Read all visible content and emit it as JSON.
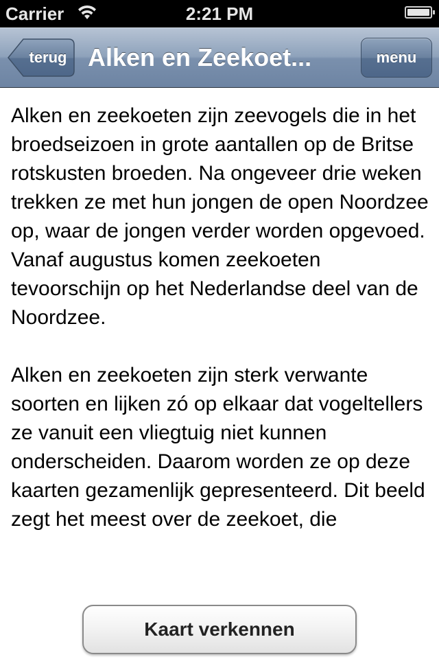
{
  "status_bar": {
    "carrier": "Carrier",
    "time": "2:21 PM",
    "wifi_icon": "wifi-icon",
    "battery_icon": "battery-icon"
  },
  "nav_bar": {
    "back_label": "terug",
    "title": "Alken en Zeekoet...",
    "menu_label": "menu"
  },
  "content": {
    "paragraphs": [
      "Alken en zeekoeten zijn zeevogels die in het broedseizoen in grote aantallen op de Britse rotskusten broeden. Na ongeveer drie weken trekken ze met hun jongen de open Noordzee op, waar de jongen verder worden opgevoed. Vanaf augustus komen zeekoeten tevoorschijn op het Nederlandse deel van de Noordzee.",
      "Alken en zeekoeten zijn sterk verwante soorten en lijken zó op elkaar dat vogeltellers ze vanuit een vliegtuig niet kunnen onderscheiden. Daarom worden ze op deze kaarten gezamenlijk gepresenteerd. Dit beeld zegt het meest over de zeekoet, die"
    ]
  },
  "action_button": {
    "label": "Kaart verkennen"
  },
  "colors": {
    "nav_bar": "#7a90ad",
    "status_bar": "#000000",
    "background": "#ffffff"
  }
}
